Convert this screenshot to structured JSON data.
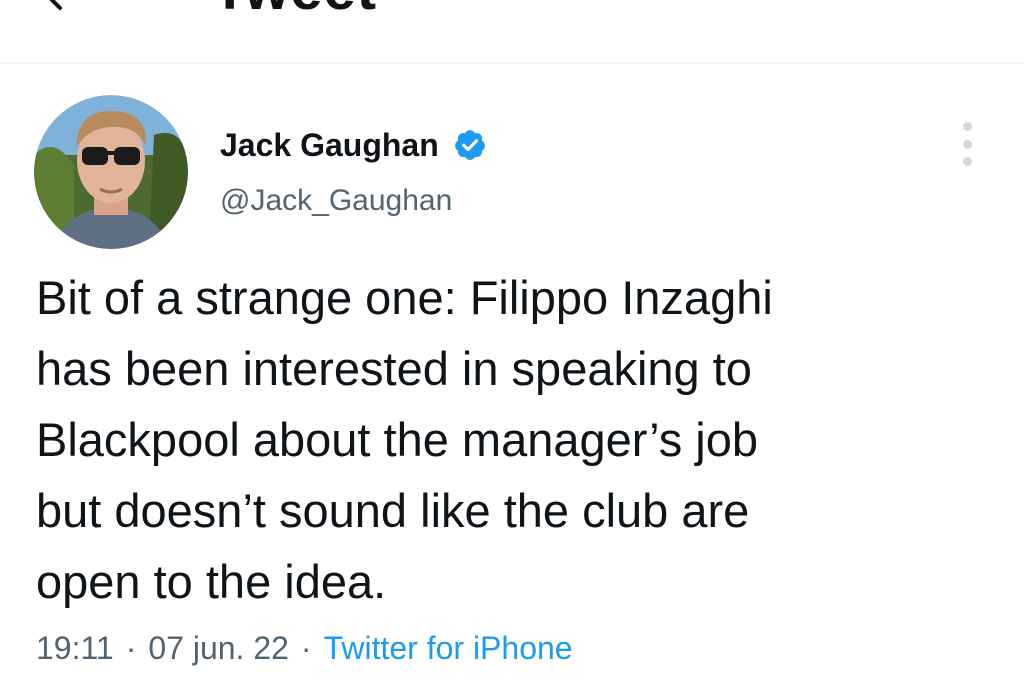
{
  "header": {
    "title": "Tweet",
    "back_icon": "arrow-left-icon"
  },
  "tweet": {
    "author": {
      "name": "Jack Gaughan",
      "handle": "@Jack_Gaughan",
      "verified": true,
      "verified_color": "#1d9bf0"
    },
    "text": "Bit of a strange one: Filippo Inzaghi\nhas been interested in speaking to\nBlackpool about the manager’s job\nbut doesn’t sound like the club are\nopen to the idea.",
    "time": "19:11",
    "date": "07 jun. 22",
    "separator": "·",
    "source": "Twitter for iPhone",
    "more_icon": "more-vertical-icon"
  },
  "colors": {
    "text_primary": "#0f1419",
    "text_secondary": "#536471",
    "link": "#1d9bf0",
    "divider": "#eff3f4"
  }
}
